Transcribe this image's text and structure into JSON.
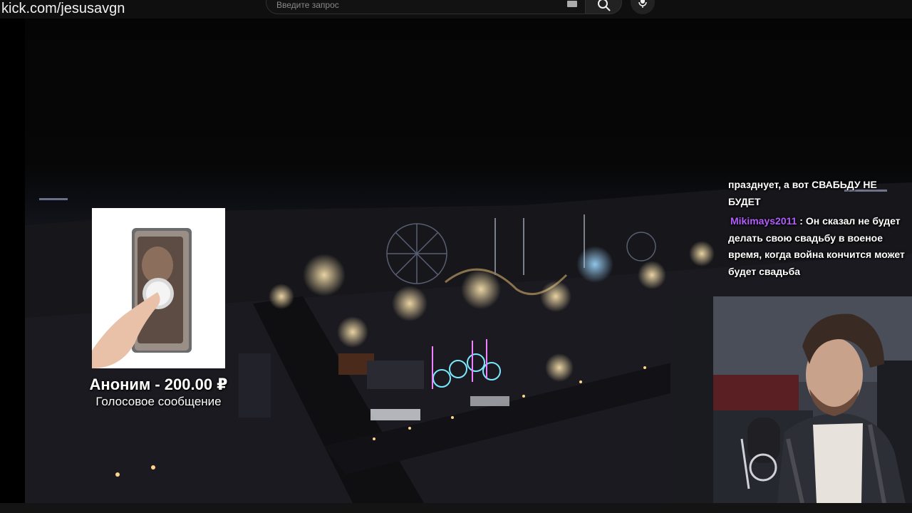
{
  "browser": {
    "url": "kick.com/jesusavgn",
    "search_placeholder": "Введите запрос"
  },
  "donation": {
    "title": "Аноним - 200.00 ₽",
    "subtitle": "Голосовое сообщение"
  },
  "chat": {
    "messages": [
      {
        "user": "",
        "text": "празднует, а вот СВАБЬДУ НЕ БУДЕТ"
      },
      {
        "user": "Mikimays2011",
        "separator": " : ",
        "text": "Он сказал не будет делать свою свадьбу в военое время, когда война кончится может будет свадьба"
      }
    ]
  },
  "colors": {
    "chat_username": "#b45cff",
    "background": "#0a0a0a"
  },
  "icons": {
    "search": "search-icon",
    "mic": "mic-icon",
    "keyboard": "keyboard-icon"
  }
}
